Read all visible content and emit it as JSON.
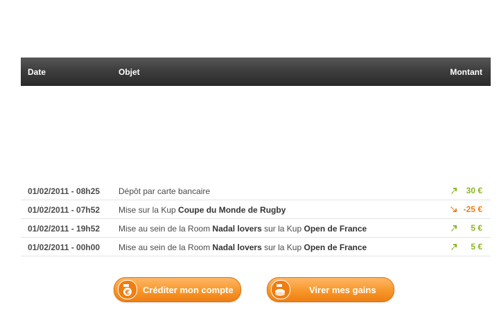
{
  "table": {
    "columns": {
      "date": "Date",
      "objet": "Objet",
      "montant": "Montant"
    },
    "rows": [
      {
        "date": "01/02/2011 - 08h25",
        "parts": [
          "Dépôt par carte bancaire"
        ],
        "direction": "up",
        "amount": "30 €",
        "color": "#8bb524"
      },
      {
        "date": "01/02/2011 - 07h52",
        "parts": [
          "Mise sur la Kup ",
          "Coupe du Monde de Rugby"
        ],
        "direction": "down",
        "amount": "-25 €",
        "color": "#ef7d1a"
      },
      {
        "date": "01/02/2011 - 19h52",
        "parts": [
          "Mise au sein de la Room ",
          "Nadal lovers",
          " sur la Kup ",
          "Open de France"
        ],
        "direction": "up",
        "amount": "5 €",
        "color": "#8bb524"
      },
      {
        "date": "01/02/2011 - 00h00",
        "parts": [
          "Mise au sein de la Room ",
          "Nadal lovers",
          " sur la Kup ",
          "Open de France"
        ],
        "direction": "up",
        "amount": "5 €",
        "color": "#8bb524"
      }
    ]
  },
  "buttons": {
    "credit_label": "Créditer mon compte",
    "credit_icon": "euro-coin-icon",
    "virer_label": "Virer mes gains",
    "virer_icon": "coins-hand-icon"
  },
  "colors": {
    "positive": "#8bb524",
    "negative": "#ef7d1a",
    "button": "#f89a2f",
    "header": "#3e3e3e"
  }
}
